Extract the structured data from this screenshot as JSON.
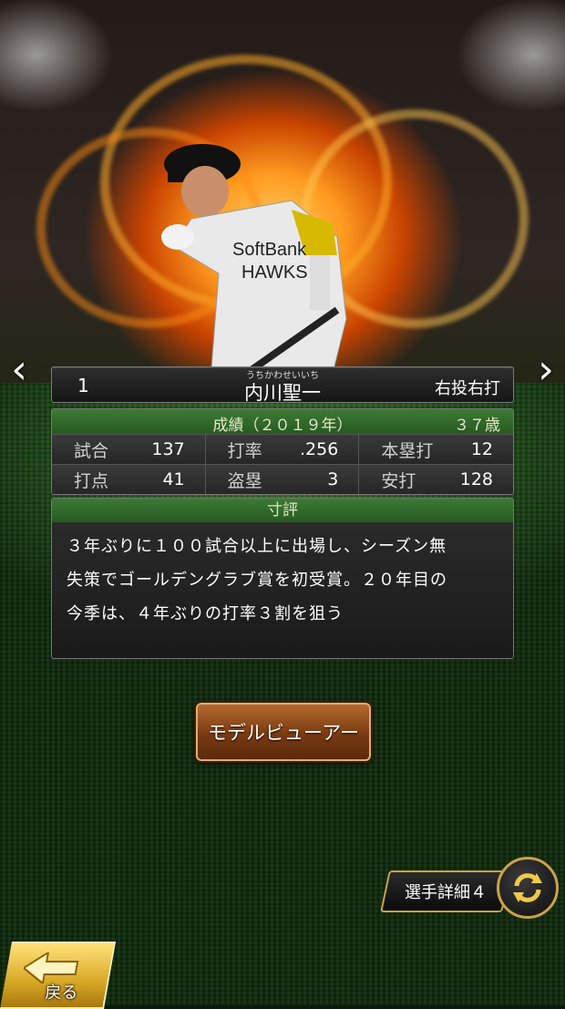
{
  "player": {
    "number": "1",
    "name_ruby": "うちかわせいいち",
    "name": "内川聖一",
    "handedness": "右投右打"
  },
  "stats": {
    "title": "成績（２０１９年）",
    "age": "３７歳",
    "items": [
      {
        "label": "試合",
        "value": "137"
      },
      {
        "label": "打率",
        "value": ".256"
      },
      {
        "label": "本塁打",
        "value": "12"
      },
      {
        "label": "打点",
        "value": "41"
      },
      {
        "label": "盗塁",
        "value": "3"
      },
      {
        "label": "安打",
        "value": "128"
      }
    ]
  },
  "comment": {
    "title": "寸評",
    "lines": [
      "３年ぶりに１００試合以上に出場し、シーズン無",
      "失策でゴールデングラブ賞を初受賞。２０年目の",
      "今季は、４年ぶりの打率３割を狙う"
    ]
  },
  "buttons": {
    "model_viewer": "モデルビューアー",
    "player_detail": "選手詳細４",
    "back": "戻る"
  },
  "colors": {
    "panel_header": "#2f6a29",
    "button_brown": "#7a3a12",
    "gold": "#c9a24a"
  },
  "icons": {
    "prev": "chevron-left-icon",
    "next": "chevron-right-icon",
    "swap": "swap-icon",
    "back": "back-arrow-icon"
  }
}
